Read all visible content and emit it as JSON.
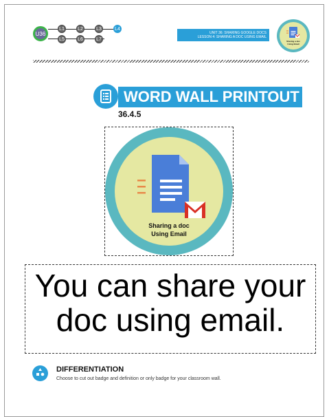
{
  "header": {
    "unit_node": "U36",
    "lesson_nodes_row1": [
      "L1",
      "L2",
      "L3"
    ],
    "current_lesson": "L4",
    "lesson_nodes_row2": [
      "L5",
      "L6",
      "L7"
    ],
    "unit_title": "UNIT 36:  SHARING GOOGLE DOCS",
    "lesson_title": "LESSON 4: SHARING A DOC USING EMAIL",
    "accent_color": "#2a9fd8",
    "current_node_color": "#2a9fd8",
    "unit_ring_color": "#3cb34a"
  },
  "badge_small": {
    "label": "Sharing a doc Using Email"
  },
  "title": {
    "text": "WORD WALL PRINTOUT",
    "code": "36.4.5",
    "icon": "list-icon"
  },
  "badge": {
    "line1": "Sharing a doc",
    "line2": "Using Email",
    "icon": "google-doc-icon"
  },
  "definition": {
    "text": "You can share your doc using email."
  },
  "differentiation": {
    "title": "DIFFERENTIATION",
    "text": "Choose to cut out badge and definition or only badge for your classroom wall.",
    "icon": "shapes-icon"
  }
}
